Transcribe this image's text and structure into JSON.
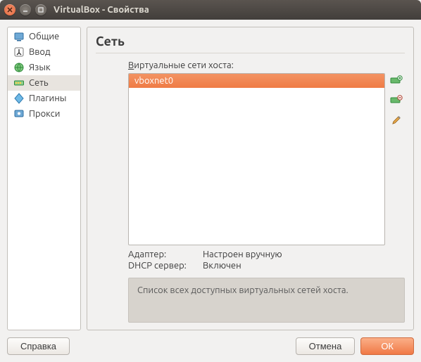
{
  "window": {
    "title": "VirtualBox - Свойства"
  },
  "sidebar": {
    "items": [
      {
        "label": "Общие",
        "icon": "general-icon"
      },
      {
        "label": "Ввод",
        "icon": "input-icon"
      },
      {
        "label": "Язык",
        "icon": "language-icon"
      },
      {
        "label": "Сеть",
        "icon": "network-icon",
        "selected": true
      },
      {
        "label": "Плагины",
        "icon": "plugins-icon"
      },
      {
        "label": "Прокси",
        "icon": "proxy-icon"
      }
    ]
  },
  "section": {
    "title": "Сеть",
    "list_label_prefix_underlined": "В",
    "list_label_rest": "иртуальные сети хоста:",
    "networks": [
      {
        "name": "vboxnet0",
        "selected": true
      }
    ],
    "details": {
      "adapter_label": "Адаптер:",
      "adapter_value": "Настроен вручную",
      "dhcp_label": "DHCP сервер:",
      "dhcp_value": "Включен"
    },
    "description": "Список всех доступных виртуальных сетей хоста."
  },
  "buttons": {
    "help": "Справка",
    "cancel": "Отмена",
    "ok": "ОК"
  },
  "colors": {
    "accent": "#ef7b45"
  }
}
